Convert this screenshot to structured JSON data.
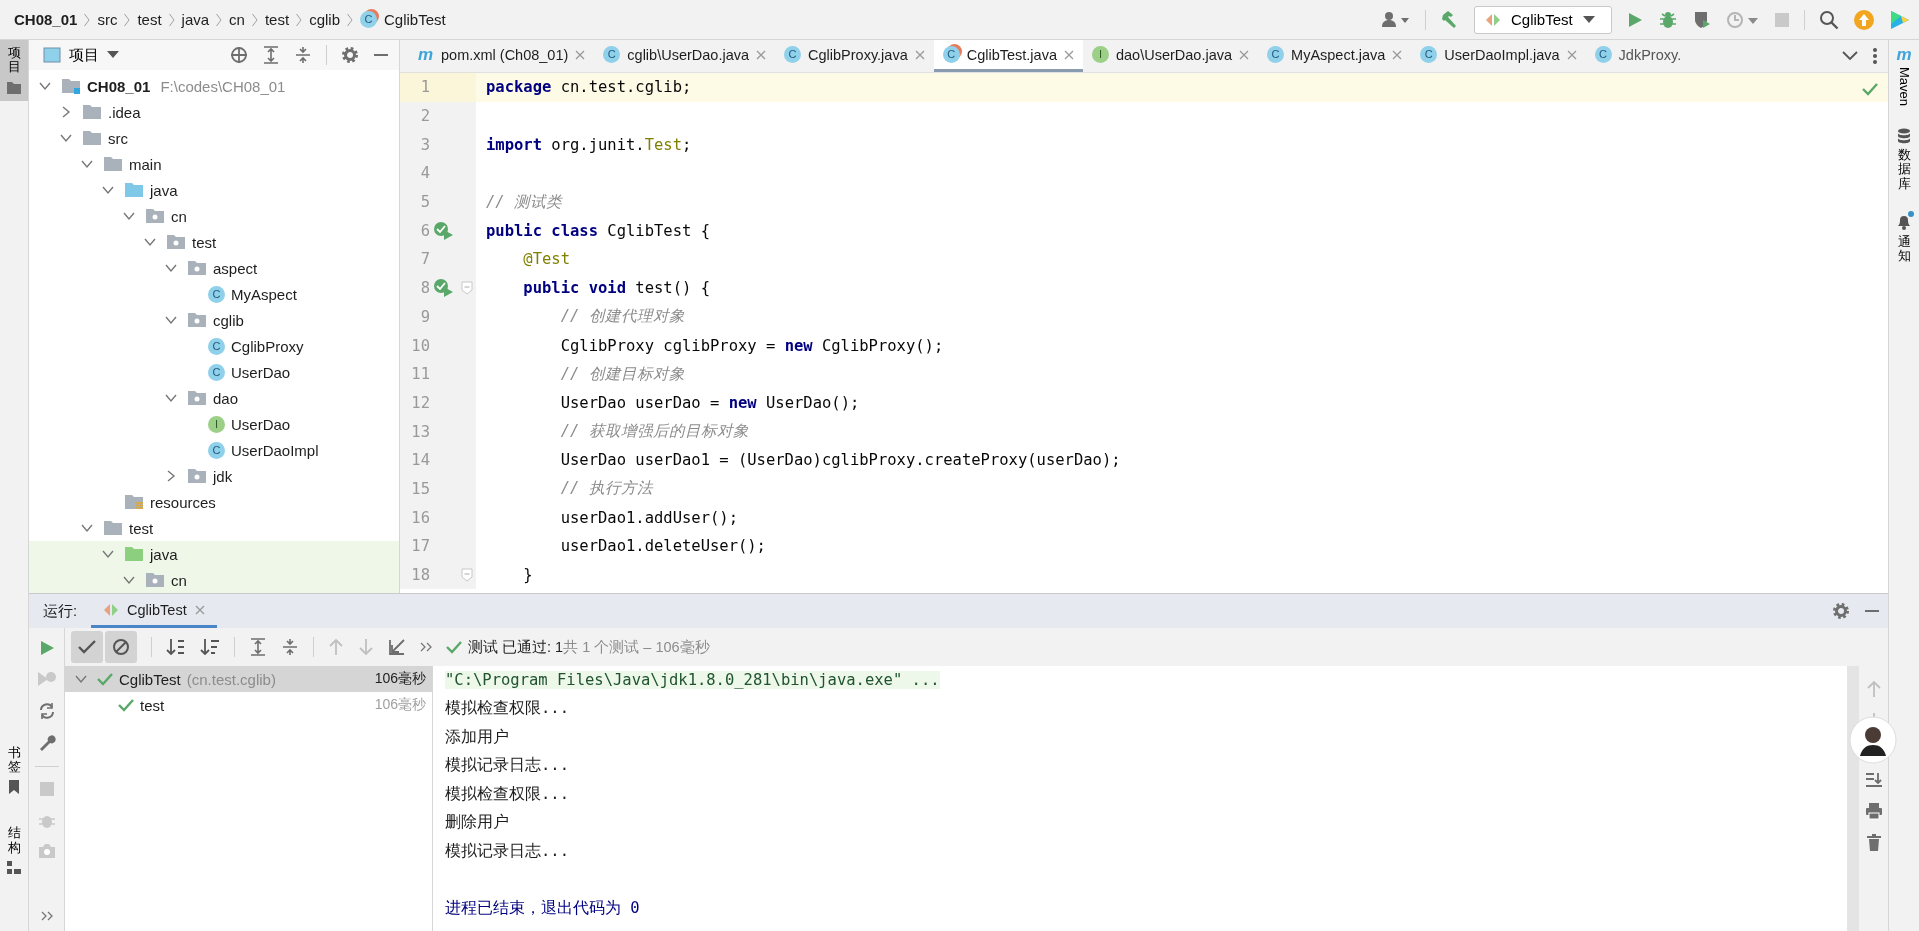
{
  "breadcrumb": [
    {
      "label": "CH08_01",
      "kind": "project"
    },
    {
      "label": "src",
      "kind": "folder"
    },
    {
      "label": "test",
      "kind": "folder"
    },
    {
      "label": "java",
      "kind": "folder"
    },
    {
      "label": "cn",
      "kind": "folder"
    },
    {
      "label": "test",
      "kind": "folder"
    },
    {
      "label": "cglib",
      "kind": "folder"
    },
    {
      "label": "CglibTest",
      "kind": "test_class",
      "icon_text": "C"
    }
  ],
  "run_config": {
    "label": "CglibTest"
  },
  "left_stripe": {
    "top": [
      {
        "label": "项目",
        "kind": "project",
        "selected": true
      }
    ],
    "bottom": [
      {
        "label": "书签",
        "kind": "bookmarks",
        "selected": false
      },
      {
        "label": "结构",
        "kind": "structure",
        "selected": false
      }
    ]
  },
  "project_panel": {
    "view": "项目",
    "tree": [
      {
        "name": "CH08_01",
        "path": "F:\\codes\\CH08_01",
        "kind": "module",
        "expanded": true,
        "children": [
          {
            "name": ".idea",
            "kind": "folder",
            "expanded": false
          },
          {
            "name": "src",
            "kind": "folder",
            "expanded": true,
            "children": [
              {
                "name": "main",
                "kind": "folder",
                "expanded": true,
                "children": [
                  {
                    "name": "java",
                    "kind": "source_root",
                    "expanded": true,
                    "children": [
                      {
                        "name": "cn",
                        "kind": "package",
                        "expanded": true,
                        "children": [
                          {
                            "name": "test",
                            "kind": "package",
                            "expanded": true,
                            "children": [
                              {
                                "name": "aspect",
                                "kind": "package",
                                "expanded": true,
                                "children": [
                                  {
                                    "name": "MyAspect",
                                    "kind": "class",
                                    "icon_text": "C"
                                  }
                                ]
                              },
                              {
                                "name": "cglib",
                                "kind": "package",
                                "expanded": true,
                                "children": [
                                  {
                                    "name": "CglibProxy",
                                    "kind": "class",
                                    "icon_text": "C"
                                  },
                                  {
                                    "name": "UserDao",
                                    "kind": "class",
                                    "icon_text": "C"
                                  }
                                ]
                              },
                              {
                                "name": "dao",
                                "kind": "package",
                                "expanded": true,
                                "children": [
                                  {
                                    "name": "UserDao",
                                    "kind": "interface",
                                    "icon_text": "I"
                                  },
                                  {
                                    "name": "UserDaoImpl",
                                    "kind": "class",
                                    "icon_text": "C"
                                  }
                                ]
                              },
                              {
                                "name": "jdk",
                                "kind": "package",
                                "expanded": false
                              }
                            ]
                          }
                        ]
                      }
                    ]
                  },
                  {
                    "name": "resources",
                    "kind": "resources"
                  }
                ]
              },
              {
                "name": "test",
                "kind": "folder",
                "expanded": true,
                "children": [
                  {
                    "name": "java",
                    "kind": "test_root",
                    "expanded": true,
                    "children": [
                      {
                        "name": "cn",
                        "kind": "package",
                        "expanded": true
                      }
                    ]
                  }
                ]
              }
            ]
          }
        ]
      }
    ]
  },
  "editor": {
    "tabs": [
      {
        "label": "pom.xml (Ch08_01)",
        "kind": "maven",
        "icon_text": "m",
        "selected": false,
        "closable": true
      },
      {
        "label": "cglib\\UserDao.java",
        "kind": "class",
        "icon_text": "C",
        "selected": false,
        "closable": true
      },
      {
        "label": "CglibProxy.java",
        "kind": "class",
        "icon_text": "C",
        "selected": false,
        "closable": true
      },
      {
        "label": "CglibTest.java",
        "kind": "test_class",
        "icon_text": "C",
        "selected": true,
        "closable": true
      },
      {
        "label": "dao\\UserDao.java",
        "kind": "interface",
        "icon_text": "I",
        "selected": false,
        "closable": true
      },
      {
        "label": "MyAspect.java",
        "kind": "class",
        "icon_text": "C",
        "selected": false,
        "closable": true
      },
      {
        "label": "UserDaoImpl.java",
        "kind": "class",
        "icon_text": "C",
        "selected": false,
        "closable": true
      },
      {
        "label": "JdkProxy.",
        "kind": "class",
        "icon_text": "C",
        "selected": false,
        "closable": false
      }
    ],
    "lines": [
      {
        "number": "1",
        "current": true,
        "run": false,
        "fold": false,
        "tokens": [
          {
            "text": "package",
            "kind": "kw"
          },
          {
            "text": " cn.test.cglib;",
            "kind": "plain"
          }
        ]
      },
      {
        "number": "2",
        "current": false,
        "run": false,
        "fold": false
      },
      {
        "number": "3",
        "current": false,
        "run": false,
        "fold": false,
        "tokens": [
          {
            "text": "import",
            "kind": "kw"
          },
          {
            "text": " org.junit.",
            "kind": "plain"
          },
          {
            "text": "Test",
            "kind": "ref"
          },
          {
            "text": ";",
            "kind": "plain"
          }
        ]
      },
      {
        "number": "4",
        "current": false,
        "run": false,
        "fold": false
      },
      {
        "number": "5",
        "current": false,
        "run": false,
        "fold": false,
        "tokens": [
          {
            "text": "// 测试类",
            "kind": "comment"
          }
        ]
      },
      {
        "number": "6",
        "current": false,
        "run": true,
        "fold": false,
        "tokens": [
          {
            "text": "public class",
            "kind": "kw"
          },
          {
            "text": " CglibTest {",
            "kind": "plain"
          }
        ]
      },
      {
        "number": "7",
        "current": false,
        "run": false,
        "fold": false,
        "tokens": [
          {
            "text": "    @Test",
            "kind": "ann"
          }
        ]
      },
      {
        "number": "8",
        "current": false,
        "run": true,
        "fold": true,
        "tokens": [
          {
            "text": "    public void",
            "kind": "kw"
          },
          {
            "text": " test() {",
            "kind": "plain"
          }
        ]
      },
      {
        "number": "9",
        "current": false,
        "run": false,
        "fold": false,
        "tokens": [
          {
            "text": "        // 创建代理对象",
            "kind": "comment"
          }
        ]
      },
      {
        "number": "10",
        "current": false,
        "run": false,
        "fold": false,
        "tokens": [
          {
            "text": "        CglibProxy cglibProxy = ",
            "kind": "plain"
          },
          {
            "text": "new",
            "kind": "kw"
          },
          {
            "text": " CglibProxy();",
            "kind": "plain"
          }
        ]
      },
      {
        "number": "11",
        "current": false,
        "run": false,
        "fold": false,
        "tokens": [
          {
            "text": "        // 创建目标对象",
            "kind": "comment"
          }
        ]
      },
      {
        "number": "12",
        "current": false,
        "run": false,
        "fold": false,
        "tokens": [
          {
            "text": "        UserDao userDao = ",
            "kind": "plain"
          },
          {
            "text": "new",
            "kind": "kw"
          },
          {
            "text": " UserDao();",
            "kind": "plain"
          }
        ]
      },
      {
        "number": "13",
        "current": false,
        "run": false,
        "fold": false,
        "tokens": [
          {
            "text": "        // 获取增强后的目标对象",
            "kind": "comment"
          }
        ]
      },
      {
        "number": "14",
        "current": false,
        "run": false,
        "fold": false,
        "tokens": [
          {
            "text": "        UserDao userDao1 = (UserDao)cglibProxy.createProxy(userDao);",
            "kind": "plain"
          }
        ]
      },
      {
        "number": "15",
        "current": false,
        "run": false,
        "fold": false,
        "tokens": [
          {
            "text": "        // 执行方法",
            "kind": "comment"
          }
        ]
      },
      {
        "number": "16",
        "current": false,
        "run": false,
        "fold": false,
        "tokens": [
          {
            "text": "        userDao1.addUser();",
            "kind": "plain"
          }
        ]
      },
      {
        "number": "17",
        "current": false,
        "run": false,
        "fold": false,
        "tokens": [
          {
            "text": "        userDao1.deleteUser();",
            "kind": "plain"
          }
        ]
      },
      {
        "number": "18",
        "current": false,
        "run": false,
        "fold": true,
        "tokens": [
          {
            "text": "    }",
            "kind": "plain"
          }
        ]
      }
    ]
  },
  "run_panel": {
    "label": "运行:",
    "tabs": [
      {
        "label": "CglibTest",
        "selected": true
      }
    ],
    "toggles": [
      {
        "kind": "show_passed",
        "selected": true
      },
      {
        "kind": "show_ignored",
        "selected": true
      }
    ],
    "status": {
      "passed": "测试 已通过: 1",
      "summary": "共 1 个测试 – 106毫秒"
    },
    "tests": [
      {
        "name": "CglibTest",
        "detail": "(cn.test.cglib)",
        "time": "106毫秒",
        "selected": true,
        "expanded": true,
        "children": [
          {
            "name": "test",
            "time": "106毫秒",
            "selected": false
          }
        ]
      }
    ],
    "console": [
      {
        "text": "\"C:\\Program Files\\Java\\jdk1.8.0_281\\bin\\java.exe\" ...",
        "kind": "command"
      },
      {
        "text": "模拟检查权限...",
        "kind": "output"
      },
      {
        "text": "添加用户",
        "kind": "output"
      },
      {
        "text": "模拟记录日志...",
        "kind": "output"
      },
      {
        "text": "模拟检查权限...",
        "kind": "output"
      },
      {
        "text": "删除用户",
        "kind": "output"
      },
      {
        "text": "模拟记录日志...",
        "kind": "output"
      },
      {
        "text": "进程已结束，退出代码为 0",
        "kind": "exit"
      }
    ]
  },
  "right_stripe": [
    {
      "label": "Maven",
      "kind": "maven",
      "icon_text": "m",
      "unread": false
    },
    {
      "label": "数据库",
      "kind": "database",
      "unread": false
    },
    {
      "label": "通知",
      "kind": "notifications",
      "unread": true
    }
  ]
}
